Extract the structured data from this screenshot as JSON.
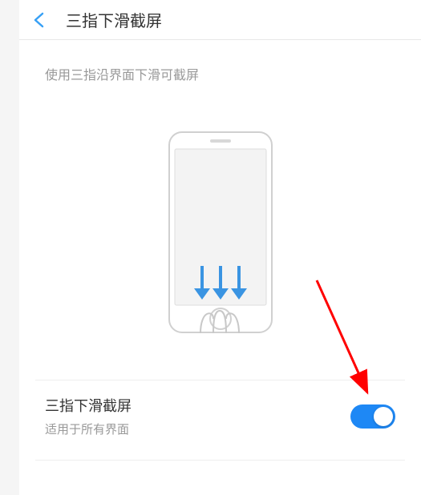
{
  "header": {
    "title": "三指下滑截屏"
  },
  "description": "使用三指沿界面下滑可截屏",
  "setting": {
    "title": "三指下滑截屏",
    "subtitle": "适用于所有界面",
    "enabled": true
  },
  "colors": {
    "accent": "#1e88f5",
    "back_arrow": "#37a0f5",
    "swipe_arrows": "#3a94e2"
  }
}
